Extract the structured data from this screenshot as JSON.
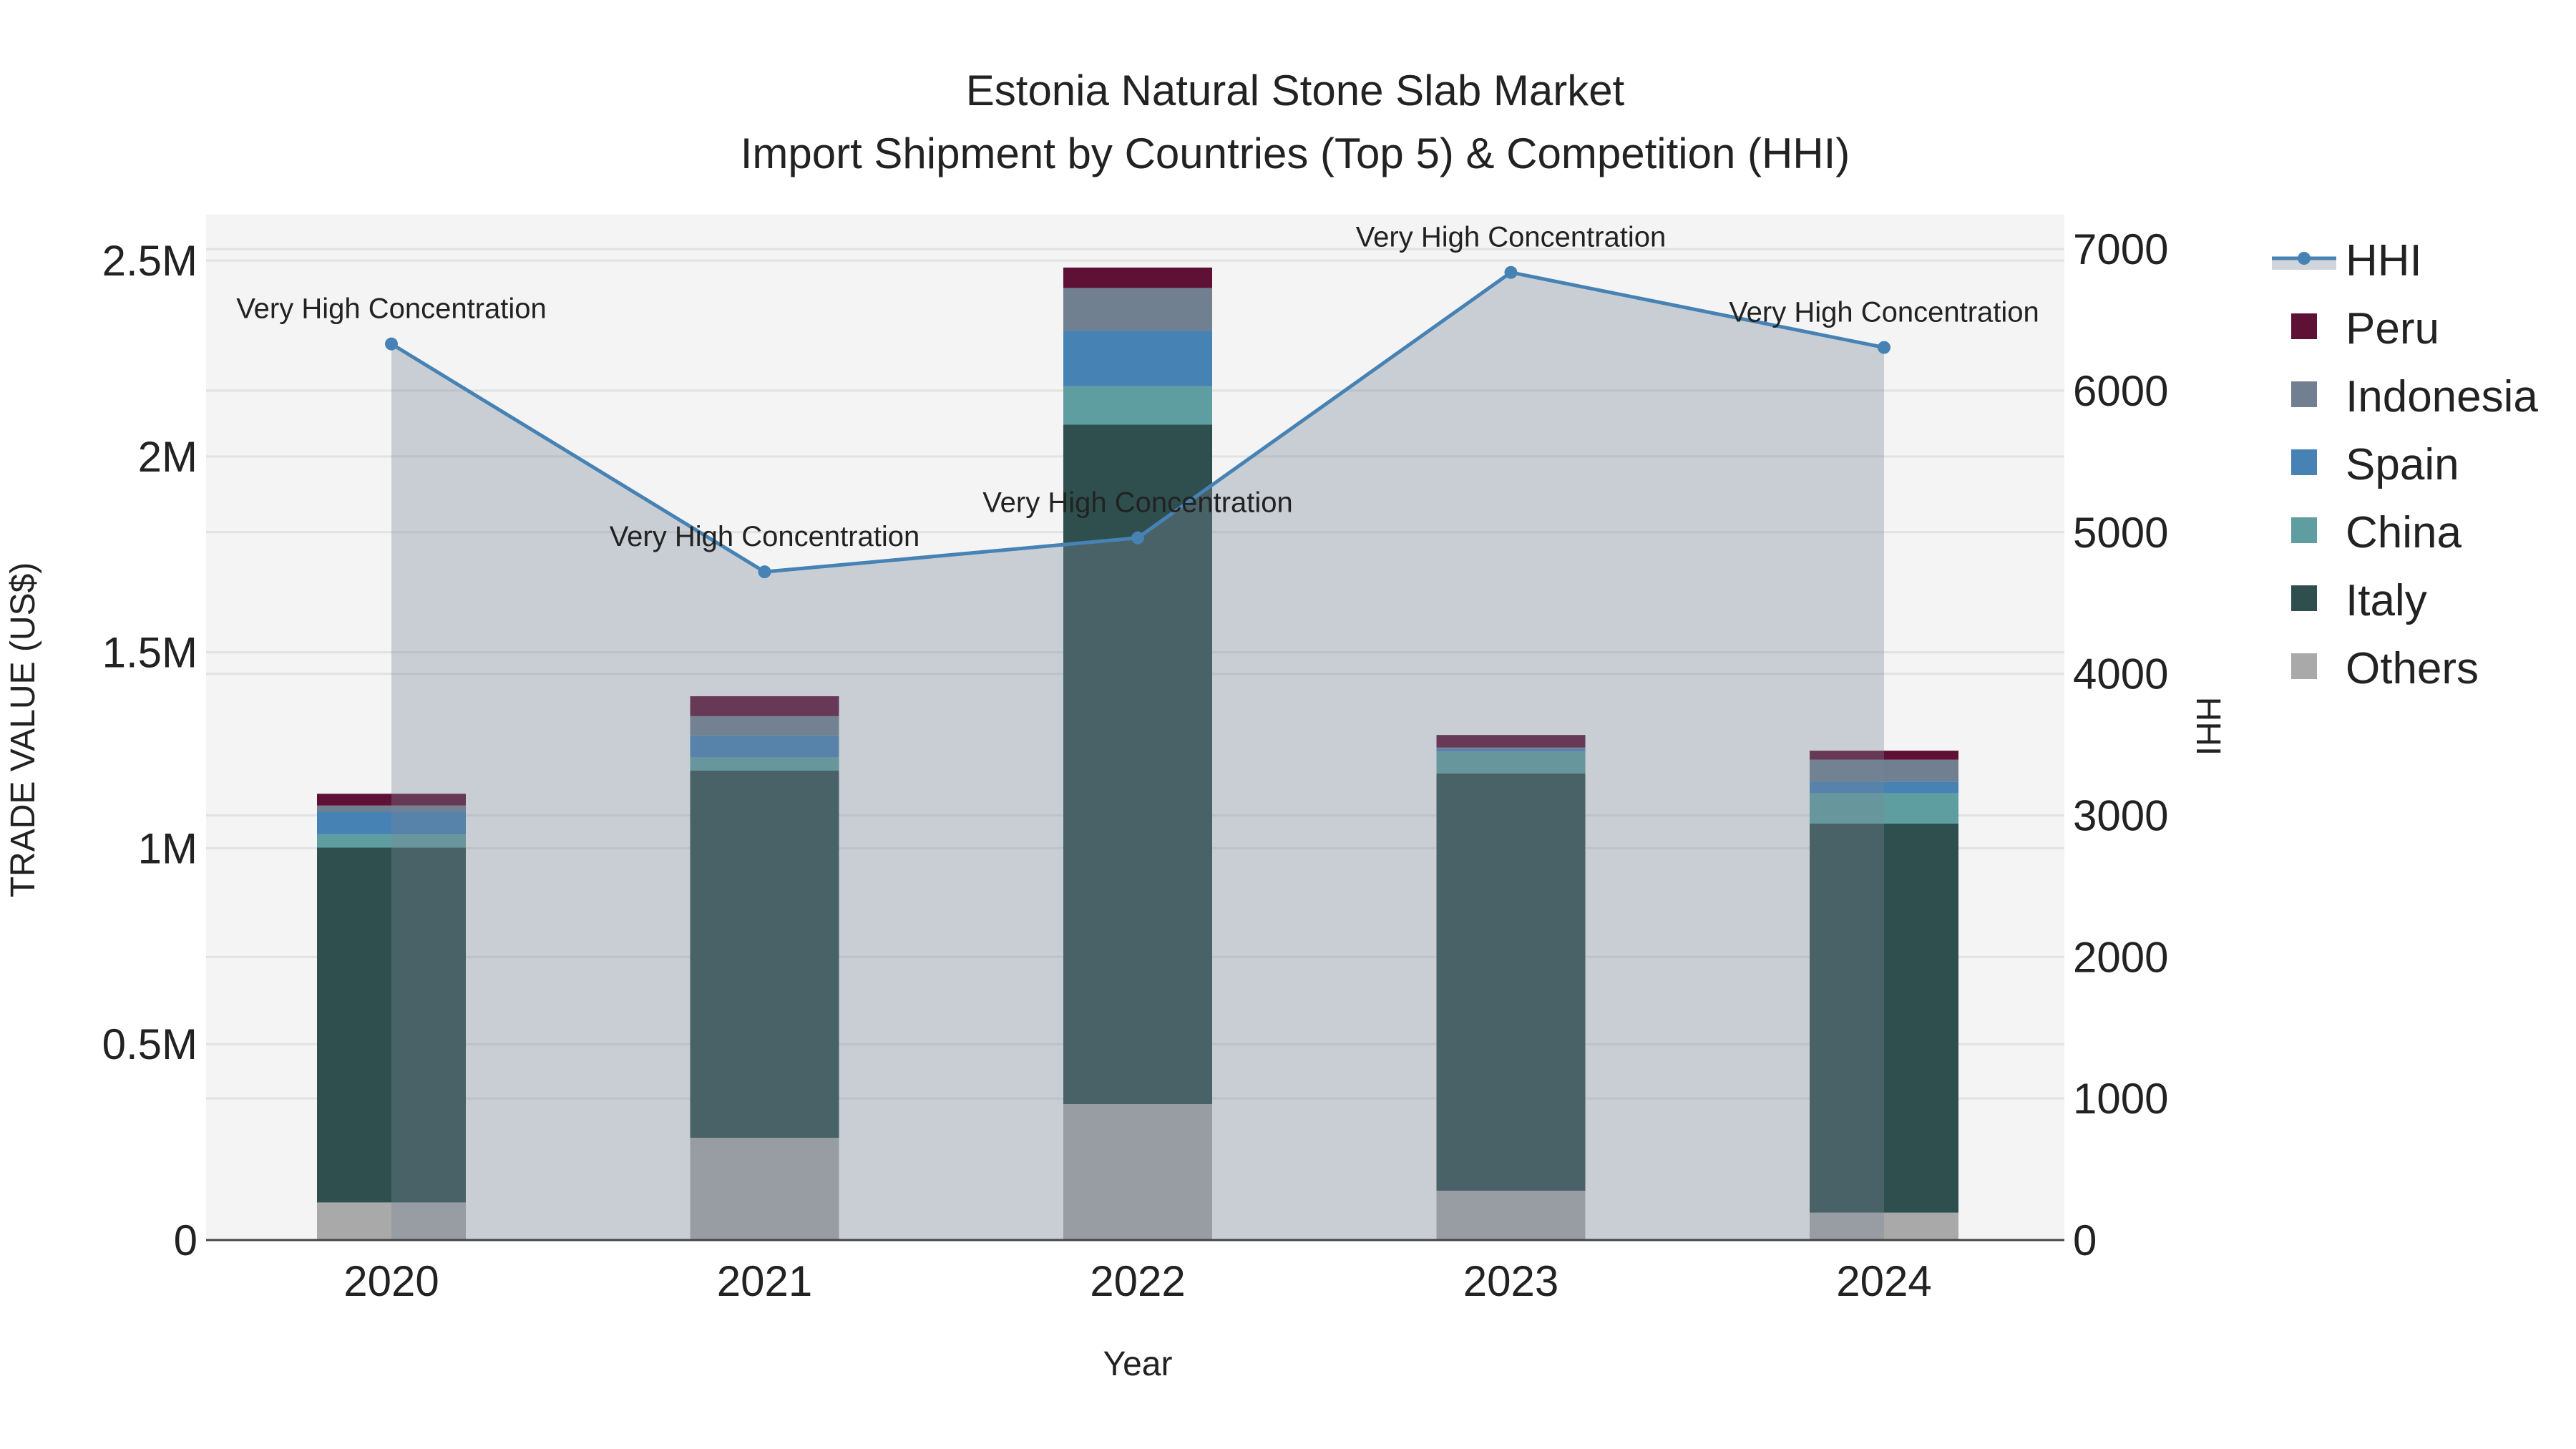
{
  "chart_data": {
    "type": "bar",
    "title": "Estonia Natural Stone Slab Market",
    "subtitle": "Import Shipment by Countries (Top 5) & Competition (HHI)",
    "xlabel": "Year",
    "ylabel": "TRADE VALUE (US$)",
    "y2label": "HHI",
    "categories": [
      "2020",
      "2021",
      "2022",
      "2023",
      "2024"
    ],
    "ylim": [
      0,
      2617000
    ],
    "y2lim": [
      0,
      7243
    ],
    "yticks": [
      0,
      500000,
      1000000,
      1500000,
      2000000,
      2500000
    ],
    "ytick_labels": [
      "0",
      "0.5M",
      "1M",
      "1.5M",
      "2M",
      "2.5M"
    ],
    "y2ticks": [
      0,
      1000,
      2000,
      3000,
      4000,
      5000,
      6000,
      7000
    ],
    "y2tick_labels": [
      "0",
      "1000",
      "2000",
      "3000",
      "4000",
      "5000",
      "6000",
      "7000"
    ],
    "grid": true,
    "legend_position": "right",
    "series": [
      {
        "name": "Others",
        "color": "#a9a9a9",
        "values": [
          96000,
          261000,
          347000,
          126000,
          70000
        ]
      },
      {
        "name": "Italy",
        "color": "#2f4f4f",
        "values": [
          906000,
          937000,
          1734000,
          1065000,
          993000
        ]
      },
      {
        "name": "China",
        "color": "#5f9ea0",
        "values": [
          33000,
          34000,
          98000,
          56000,
          77000
        ]
      },
      {
        "name": "Spain",
        "color": "#4682b4",
        "values": [
          58000,
          56000,
          142000,
          7000,
          30000
        ]
      },
      {
        "name": "Indonesia",
        "color": "#708090",
        "values": [
          16000,
          49000,
          109000,
          3000,
          56000
        ]
      },
      {
        "name": "Peru",
        "color": "#5e1035",
        "values": [
          30000,
          51000,
          52000,
          32000,
          23000
        ]
      }
    ],
    "line": {
      "name": "HHI",
      "color": "#4682b4",
      "fill": "#778899",
      "values": [
        6330,
        4720,
        4960,
        6835,
        6305
      ],
      "annotations": [
        "Very High Concentration",
        "Very High Concentration",
        "Very High Concentration",
        "Very High Concentration",
        "Very High Concentration"
      ]
    },
    "legend": [
      "HHI",
      "Peru",
      "Indonesia",
      "Spain",
      "China",
      "Italy",
      "Others"
    ]
  }
}
